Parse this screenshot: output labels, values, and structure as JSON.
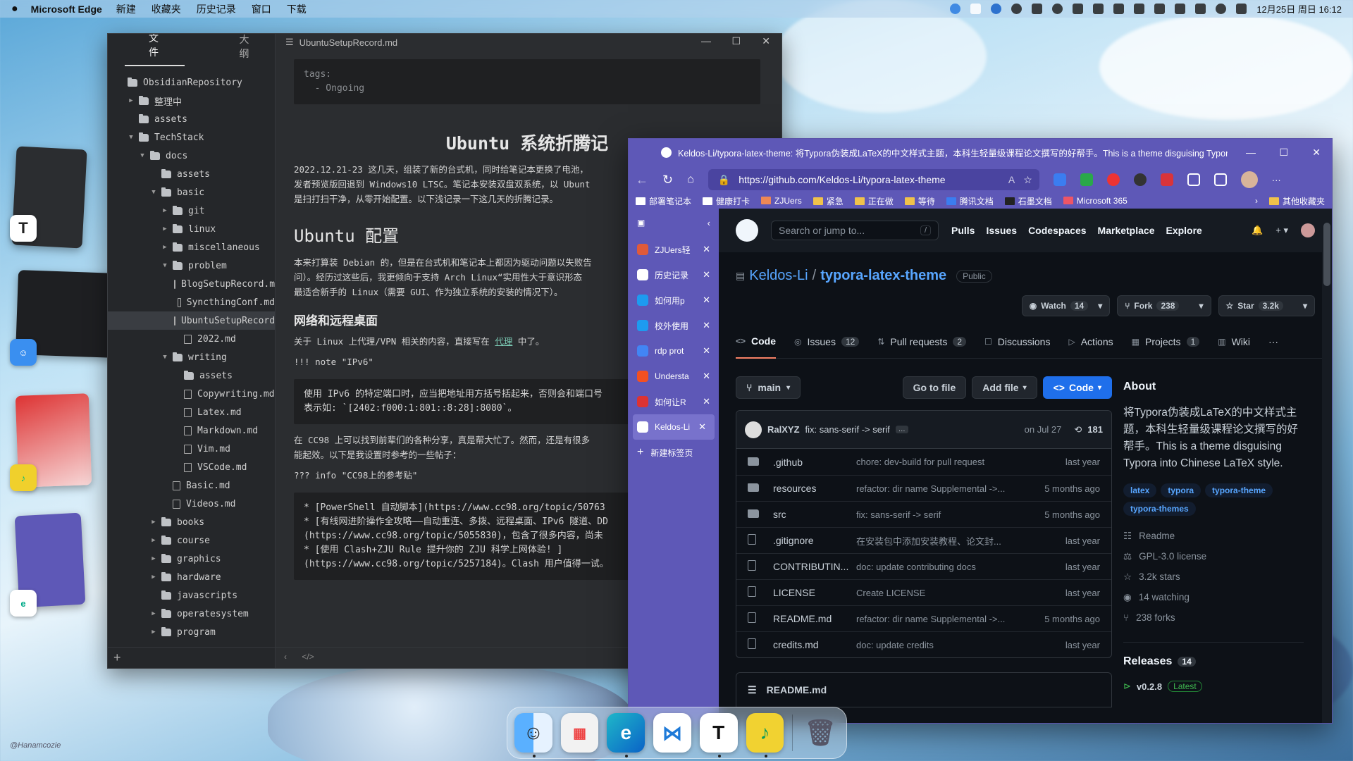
{
  "menubar": {
    "app": "Microsoft Edge",
    "items": [
      "新建",
      "收藏夹",
      "历史记录",
      "窗口",
      "下载"
    ],
    "datetime": "12月25日 周日 16:12"
  },
  "typora": {
    "tabs": [
      "文件",
      "大纲"
    ],
    "title": "UbuntuSetupRecord.md",
    "tree": [
      {
        "label": "ObsidianRepository",
        "type": "folder",
        "depth": 0,
        "toggle": ""
      },
      {
        "label": "整理中",
        "type": "folder",
        "depth": 1,
        "toggle": "▶"
      },
      {
        "label": "assets",
        "type": "folder",
        "depth": 1,
        "toggle": ""
      },
      {
        "label": "TechStack",
        "type": "folder",
        "depth": 1,
        "toggle": "▼"
      },
      {
        "label": "docs",
        "type": "folder",
        "depth": 2,
        "toggle": "▼"
      },
      {
        "label": "assets",
        "type": "folder",
        "depth": 3,
        "toggle": ""
      },
      {
        "label": "basic",
        "type": "folder",
        "depth": 3,
        "toggle": "▼"
      },
      {
        "label": "git",
        "type": "folder",
        "depth": 4,
        "toggle": "▶"
      },
      {
        "label": "linux",
        "type": "folder",
        "depth": 4,
        "toggle": "▶"
      },
      {
        "label": "miscellaneous",
        "type": "folder",
        "depth": 4,
        "toggle": "▶"
      },
      {
        "label": "problem",
        "type": "folder",
        "depth": 4,
        "toggle": "▼"
      },
      {
        "label": "BlogSetupRecord.m",
        "type": "file",
        "depth": 5,
        "toggle": ""
      },
      {
        "label": "SyncthingConf.md",
        "type": "file",
        "depth": 5,
        "toggle": ""
      },
      {
        "label": "UbuntuSetupRecord",
        "type": "file",
        "depth": 5,
        "toggle": "",
        "selected": true
      },
      {
        "label": "2022.md",
        "type": "file",
        "depth": 5,
        "toggle": ""
      },
      {
        "label": "writing",
        "type": "folder",
        "depth": 4,
        "toggle": "▼"
      },
      {
        "label": "assets",
        "type": "folder",
        "depth": 5,
        "toggle": ""
      },
      {
        "label": "Copywriting.md",
        "type": "file",
        "depth": 5,
        "toggle": ""
      },
      {
        "label": "Latex.md",
        "type": "file",
        "depth": 5,
        "toggle": ""
      },
      {
        "label": "Markdown.md",
        "type": "file",
        "depth": 5,
        "toggle": ""
      },
      {
        "label": "Vim.md",
        "type": "file",
        "depth": 5,
        "toggle": ""
      },
      {
        "label": "VSCode.md",
        "type": "file",
        "depth": 5,
        "toggle": ""
      },
      {
        "label": "Basic.md",
        "type": "file",
        "depth": 4,
        "toggle": ""
      },
      {
        "label": "Videos.md",
        "type": "file",
        "depth": 4,
        "toggle": ""
      },
      {
        "label": "books",
        "type": "folder",
        "depth": 3,
        "toggle": "▶"
      },
      {
        "label": "course",
        "type": "folder",
        "depth": 3,
        "toggle": "▶"
      },
      {
        "label": "graphics",
        "type": "folder",
        "depth": 3,
        "toggle": "▶"
      },
      {
        "label": "hardware",
        "type": "folder",
        "depth": 3,
        "toggle": "▶"
      },
      {
        "label": "javascripts",
        "type": "folder",
        "depth": 3,
        "toggle": ""
      },
      {
        "label": "operatesystem",
        "type": "folder",
        "depth": 3,
        "toggle": "▶"
      },
      {
        "label": "program",
        "type": "folder",
        "depth": 3,
        "toggle": "▶"
      }
    ],
    "frontmatter": "tags:\n  - Ongoing",
    "h1": "Ubuntu 系统折腾记",
    "p1": "2022.12.21-23 这几天，组装了新的台式机，同时给笔记本更换了电池，",
    "p1b": "发者预览版回退到 Windows10 LTSC。笔记本安装双盘双系统，以 Ubunt",
    "p1c": "是扫打扫干净，从零开始配置。以下浅记录一下这几天的折腾记录。",
    "h2": "Ubuntu 配置",
    "p2": "本来打算装 Debian 的，但是在台式机和笔记本上都因为驱动问题以失败告",
    "p2b": "问）。经历过这些后，我更倾向于支持 Arch Linux“实用性大于意识形态",
    "p2c": "最适合新手的 Linux（需要 GUI、作为独立系统的安装的情况下）。",
    "h3": "网络和远程桌面",
    "p3_pre": "关于 Linux 上代理/VPN 相关的内容，直接写在",
    "p3_link": "代理",
    "p3_post": "中了。",
    "note": "!!! note \"IPv6\"",
    "code2": "使用 IPv6 的特定端口时，应当把地址用方括号括起来，否则会和端口号\n表示如: `[2402:f000:1:801::8:28]:8080`。",
    "p4": "在 CC98 上可以找到前辈们的各种分享，真是帮大忙了。然而，还是有很多",
    "p4b": "能起效。以下是我设置时参考的一些帖子：",
    "info": "??? info \"CC98上的参考贴\"",
    "code3": "* [PowerShell 自动脚本](https://www.cc98.org/topic/50763\n* [有线网进阶操作全攻略——自动重连、多拨、远程桌面、IPv6 隧道、DD\n(https://www.cc98.org/topic/5055830)，包含了很多内容，尚未\n* [使用 Clash+ZJU Rule 提升你的 ZJU 科学上网体验! ]\n(https://www.cc98.org/topic/5257184)。Clash 用户值得一试。"
  },
  "edge": {
    "title": "Keldos-Li/typora-latex-theme: 将Typora伪装成LaTeX的中文样式主题，本科生轻量级课程论文撰写的好帮手。This is a theme disguising Typora int...",
    "url": "https://github.com/Keldos-Li/typora-latex-theme",
    "bookmarks": [
      "部署笔记本",
      "健康打卡",
      "ZJUers",
      "紧急",
      "正在做",
      "等待",
      "腾讯文档",
      "石墨文档",
      "Microsoft 365",
      "其他收藏夹"
    ],
    "vtabs": [
      {
        "label": "ZJUers轻",
        "color": "#e05a3a"
      },
      {
        "label": "历史记录",
        "color": "#ffffff"
      },
      {
        "label": "如何用p",
        "color": "#1d9bf0"
      },
      {
        "label": "校外使用",
        "color": "#1d9bf0"
      },
      {
        "label": "rdp prot",
        "color": "#4285f4"
      },
      {
        "label": "Understa",
        "color": "#f25022"
      },
      {
        "label": "如何让R",
        "color": "#d33"
      },
      {
        "label": "Keldos-Li",
        "color": "#ffffff",
        "active": true
      }
    ],
    "new_tab": "新建标签页"
  },
  "github": {
    "search_placeholder": "Search or jump to...",
    "search_key": "/",
    "nav": [
      "Pulls",
      "Issues",
      "Codespaces",
      "Marketplace",
      "Explore"
    ],
    "owner": "Keldos-Li",
    "repo": "typora-latex-theme",
    "visibility": "Public",
    "watch": {
      "label": "Watch",
      "count": "14"
    },
    "fork": {
      "label": "Fork",
      "count": "238"
    },
    "star": {
      "label": "Star",
      "count": "3.2k"
    },
    "tabs": [
      {
        "label": "Code",
        "count": ""
      },
      {
        "label": "Issues",
        "count": "12"
      },
      {
        "label": "Pull requests",
        "count": "2"
      },
      {
        "label": "Discussions",
        "count": ""
      },
      {
        "label": "Actions",
        "count": ""
      },
      {
        "label": "Projects",
        "count": "1"
      },
      {
        "label": "Wiki",
        "count": ""
      }
    ],
    "branch": "main",
    "go_to_file": "Go to file",
    "add_file": "Add file",
    "code_btn": "Code",
    "commit": {
      "author": "RalXYZ",
      "message": "fix: sans-serif -> serif",
      "date": "on Jul 27",
      "count": "181"
    },
    "files": [
      {
        "name": ".github",
        "dir": true,
        "msg": "chore: dev-build for pull request",
        "time": "last year"
      },
      {
        "name": "resources",
        "dir": true,
        "msg": "refactor: dir name Supplemental ->...",
        "time": "5 months ago"
      },
      {
        "name": "src",
        "dir": true,
        "msg": "fix: sans-serif -> serif",
        "time": "5 months ago"
      },
      {
        "name": ".gitignore",
        "dir": false,
        "msg": "在安装包中添加安装教程、论文封...",
        "time": "last year"
      },
      {
        "name": "CONTRIBUTIN...",
        "dir": false,
        "msg": "doc: update contributing docs",
        "time": "last year"
      },
      {
        "name": "LICENSE",
        "dir": false,
        "msg": "Create LICENSE",
        "time": "last year"
      },
      {
        "name": "README.md",
        "dir": false,
        "msg": "refactor: dir name Supplemental ->...",
        "time": "5 months ago"
      },
      {
        "name": "credits.md",
        "dir": false,
        "msg": "doc: update credits",
        "time": "last year"
      }
    ],
    "readme_title": "README.md",
    "about_title": "About",
    "about": "将Typora伪装成LaTeX的中文样式主题，本科生轻量级课程论文撰写的好帮手。This is a theme disguising Typora into Chinese LaTeX style.",
    "topics": [
      "latex",
      "typora",
      "typora-theme",
      "typora-themes"
    ],
    "meta": [
      "Readme",
      "GPL-3.0 license",
      "3.2k stars",
      "14 watching",
      "238 forks"
    ],
    "releases": {
      "label": "Releases",
      "count": "14",
      "version": "v0.2.8",
      "badge": "Latest"
    }
  },
  "dock": [
    "finder",
    "launchpad",
    "edge",
    "vscode",
    "typora",
    "music",
    "trash"
  ],
  "signature": "@Hanamcozie"
}
